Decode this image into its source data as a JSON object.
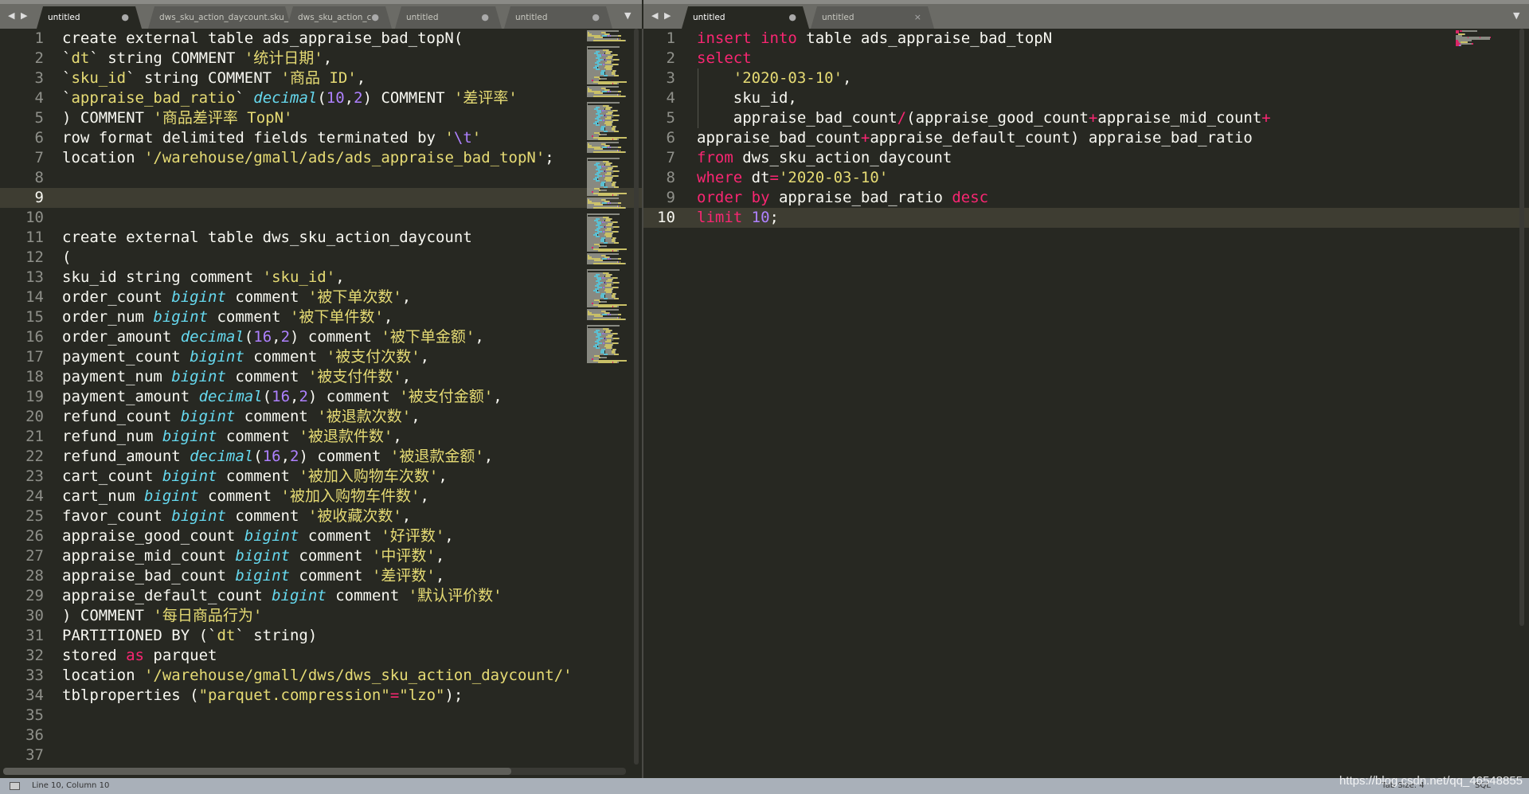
{
  "left_tabs": [
    {
      "label": "untitled",
      "mark": "●",
      "active": true
    },
    {
      "label": "dws_sku_action_daycount.sku_id",
      "mark": "",
      "active": false
    },
    {
      "label": "dws_sku_action_c",
      "mark": "●",
      "active": false
    },
    {
      "label": "untitled",
      "mark": "●",
      "active": false
    },
    {
      "label": "untitled",
      "mark": "●",
      "active": false
    }
  ],
  "right_tabs": [
    {
      "label": "untitled",
      "mark": "●",
      "active": true
    },
    {
      "label": "untitled",
      "mark": "×",
      "active": false
    }
  ],
  "icons": {
    "nav": "◀ ▶",
    "dropdown": "▼"
  },
  "colors": {
    "background": "#272822",
    "keyword": "#f92672",
    "string": "#e6db74",
    "type": "#66d9ef",
    "number": "#ae81ff"
  },
  "left_editor": {
    "current_line": 9,
    "lines": [
      [
        [
          "p",
          "create external table ads_appraise_bad_topN("
        ]
      ],
      [
        [
          "p",
          "`"
        ],
        [
          "s",
          "dt"
        ],
        [
          "p",
          "` string COMMENT "
        ],
        [
          "s",
          "'统计日期'"
        ],
        [
          "p",
          ","
        ]
      ],
      [
        [
          "p",
          "`"
        ],
        [
          "s",
          "sku_id"
        ],
        [
          "p",
          "` string COMMENT "
        ],
        [
          "s",
          "'商品 ID'"
        ],
        [
          "p",
          ","
        ]
      ],
      [
        [
          "p",
          "`"
        ],
        [
          "s",
          "appraise_bad_ratio"
        ],
        [
          "p",
          "` "
        ],
        [
          "t",
          "decimal"
        ],
        [
          "p",
          "("
        ],
        [
          "n",
          "10"
        ],
        [
          "p",
          ","
        ],
        [
          "n",
          "2"
        ],
        [
          "p",
          ") COMMENT "
        ],
        [
          "s",
          "'差评率'"
        ]
      ],
      [
        [
          "p",
          ") COMMENT "
        ],
        [
          "s",
          "'商品差评率 TopN'"
        ]
      ],
      [
        [
          "p",
          "row format delimited fields terminated by "
        ],
        [
          "s",
          "'"
        ],
        [
          "n",
          "\\t"
        ],
        [
          "s",
          "'"
        ]
      ],
      [
        [
          "p",
          "location "
        ],
        [
          "s",
          "'/warehouse/gmall/ads/ads_appraise_bad_topN'"
        ],
        [
          "p",
          ";"
        ]
      ],
      [],
      [],
      [],
      [
        [
          "p",
          "create external table dws_sku_action_daycount"
        ]
      ],
      [
        [
          "p",
          "("
        ]
      ],
      [
        [
          "p",
          "sku_id string comment "
        ],
        [
          "s",
          "'sku_id'"
        ],
        [
          "p",
          ","
        ]
      ],
      [
        [
          "p",
          "order_count "
        ],
        [
          "t",
          "bigint"
        ],
        [
          "p",
          " comment "
        ],
        [
          "s",
          "'被下单次数'"
        ],
        [
          "p",
          ","
        ]
      ],
      [
        [
          "p",
          "order_num "
        ],
        [
          "t",
          "bigint"
        ],
        [
          "p",
          " comment "
        ],
        [
          "s",
          "'被下单件数'"
        ],
        [
          "p",
          ","
        ]
      ],
      [
        [
          "p",
          "order_amount "
        ],
        [
          "t",
          "decimal"
        ],
        [
          "p",
          "("
        ],
        [
          "n",
          "16"
        ],
        [
          "p",
          ","
        ],
        [
          "n",
          "2"
        ],
        [
          "p",
          ") comment "
        ],
        [
          "s",
          "'被下单金额'"
        ],
        [
          "p",
          ","
        ]
      ],
      [
        [
          "p",
          "payment_count "
        ],
        [
          "t",
          "bigint"
        ],
        [
          "p",
          " comment "
        ],
        [
          "s",
          "'被支付次数'"
        ],
        [
          "p",
          ","
        ]
      ],
      [
        [
          "p",
          "payment_num "
        ],
        [
          "t",
          "bigint"
        ],
        [
          "p",
          " comment "
        ],
        [
          "s",
          "'被支付件数'"
        ],
        [
          "p",
          ","
        ]
      ],
      [
        [
          "p",
          "payment_amount "
        ],
        [
          "t",
          "decimal"
        ],
        [
          "p",
          "("
        ],
        [
          "n",
          "16"
        ],
        [
          "p",
          ","
        ],
        [
          "n",
          "2"
        ],
        [
          "p",
          ") comment "
        ],
        [
          "s",
          "'被支付金额'"
        ],
        [
          "p",
          ","
        ]
      ],
      [
        [
          "p",
          "refund_count "
        ],
        [
          "t",
          "bigint"
        ],
        [
          "p",
          " comment "
        ],
        [
          "s",
          "'被退款次数'"
        ],
        [
          "p",
          ","
        ]
      ],
      [
        [
          "p",
          "refund_num "
        ],
        [
          "t",
          "bigint"
        ],
        [
          "p",
          " comment "
        ],
        [
          "s",
          "'被退款件数'"
        ],
        [
          "p",
          ","
        ]
      ],
      [
        [
          "p",
          "refund_amount "
        ],
        [
          "t",
          "decimal"
        ],
        [
          "p",
          "("
        ],
        [
          "n",
          "16"
        ],
        [
          "p",
          ","
        ],
        [
          "n",
          "2"
        ],
        [
          "p",
          ") comment "
        ],
        [
          "s",
          "'被退款金额'"
        ],
        [
          "p",
          ","
        ]
      ],
      [
        [
          "p",
          "cart_count "
        ],
        [
          "t",
          "bigint"
        ],
        [
          "p",
          " comment "
        ],
        [
          "s",
          "'被加入购物车次数'"
        ],
        [
          "p",
          ","
        ]
      ],
      [
        [
          "p",
          "cart_num "
        ],
        [
          "t",
          "bigint"
        ],
        [
          "p",
          " comment "
        ],
        [
          "s",
          "'被加入购物车件数'"
        ],
        [
          "p",
          ","
        ]
      ],
      [
        [
          "p",
          "favor_count "
        ],
        [
          "t",
          "bigint"
        ],
        [
          "p",
          " comment "
        ],
        [
          "s",
          "'被收藏次数'"
        ],
        [
          "p",
          ","
        ]
      ],
      [
        [
          "p",
          "appraise_good_count "
        ],
        [
          "t",
          "bigint"
        ],
        [
          "p",
          " comment "
        ],
        [
          "s",
          "'好评数'"
        ],
        [
          "p",
          ","
        ]
      ],
      [
        [
          "p",
          "appraise_mid_count "
        ],
        [
          "t",
          "bigint"
        ],
        [
          "p",
          " comment "
        ],
        [
          "s",
          "'中评数'"
        ],
        [
          "p",
          ","
        ]
      ],
      [
        [
          "p",
          "appraise_bad_count "
        ],
        [
          "t",
          "bigint"
        ],
        [
          "p",
          " comment "
        ],
        [
          "s",
          "'差评数'"
        ],
        [
          "p",
          ","
        ]
      ],
      [
        [
          "p",
          "appraise_default_count "
        ],
        [
          "t",
          "bigint"
        ],
        [
          "p",
          " comment "
        ],
        [
          "s",
          "'默认评价数'"
        ]
      ],
      [
        [
          "p",
          ") COMMENT "
        ],
        [
          "s",
          "'每日商品行为'"
        ]
      ],
      [
        [
          "p",
          "PARTITIONED BY (`"
        ],
        [
          "s",
          "dt"
        ],
        [
          "p",
          "` string)"
        ]
      ],
      [
        [
          "p",
          "stored "
        ],
        [
          "k",
          "as"
        ],
        [
          "p",
          " parquet"
        ]
      ],
      [
        [
          "p",
          "location "
        ],
        [
          "s",
          "'/warehouse/gmall/dws/dws_sku_action_daycount/'"
        ]
      ],
      [
        [
          "p",
          "tblproperties ("
        ],
        [
          "s",
          "\"parquet.compression\""
        ],
        [
          "k",
          "="
        ],
        [
          "s",
          "\"lzo\""
        ],
        [
          "p",
          ");"
        ]
      ],
      [],
      [],
      []
    ]
  },
  "right_editor": {
    "current_line": 10,
    "lines": [
      [
        [
          "k",
          "insert"
        ],
        [
          "p",
          " "
        ],
        [
          "k",
          "into"
        ],
        [
          "p",
          " table ads_appraise_bad_topN"
        ]
      ],
      [
        [
          "k",
          "select"
        ]
      ],
      [
        [
          "p",
          "    "
        ],
        [
          "s",
          "'2020-03-10'"
        ],
        [
          "p",
          ","
        ]
      ],
      [
        [
          "p",
          "    sku_id,"
        ]
      ],
      [
        [
          "p",
          "    appraise_bad_count"
        ],
        [
          "k",
          "/"
        ],
        [
          "p",
          "(appraise_good_count"
        ],
        [
          "k",
          "+"
        ],
        [
          "p",
          "appraise_mid_count"
        ],
        [
          "k",
          "+"
        ]
      ],
      [
        [
          "p",
          "appraise_bad_count"
        ],
        [
          "k",
          "+"
        ],
        [
          "p",
          "appraise_default_count) appraise_bad_ratio"
        ]
      ],
      [
        [
          "k",
          "from"
        ],
        [
          "p",
          " dws_sku_action_daycount"
        ]
      ],
      [
        [
          "k",
          "where"
        ],
        [
          "p",
          " dt"
        ],
        [
          "k",
          "="
        ],
        [
          "s",
          "'2020-03-10'"
        ]
      ],
      [
        [
          "k",
          "order"
        ],
        [
          "p",
          " "
        ],
        [
          "k",
          "by"
        ],
        [
          "p",
          " appraise_bad_ratio "
        ],
        [
          "k",
          "desc"
        ]
      ],
      [
        [
          "k",
          "limit"
        ],
        [
          "p",
          " "
        ],
        [
          "n",
          "10"
        ],
        [
          "p",
          ";"
        ]
      ]
    ]
  },
  "status": {
    "position": "Line 10, Column 10",
    "tab_size": "Tab Size: 4",
    "syntax": "SQL",
    "watermark": "https://blog.csdn.net/qq_46548855"
  }
}
